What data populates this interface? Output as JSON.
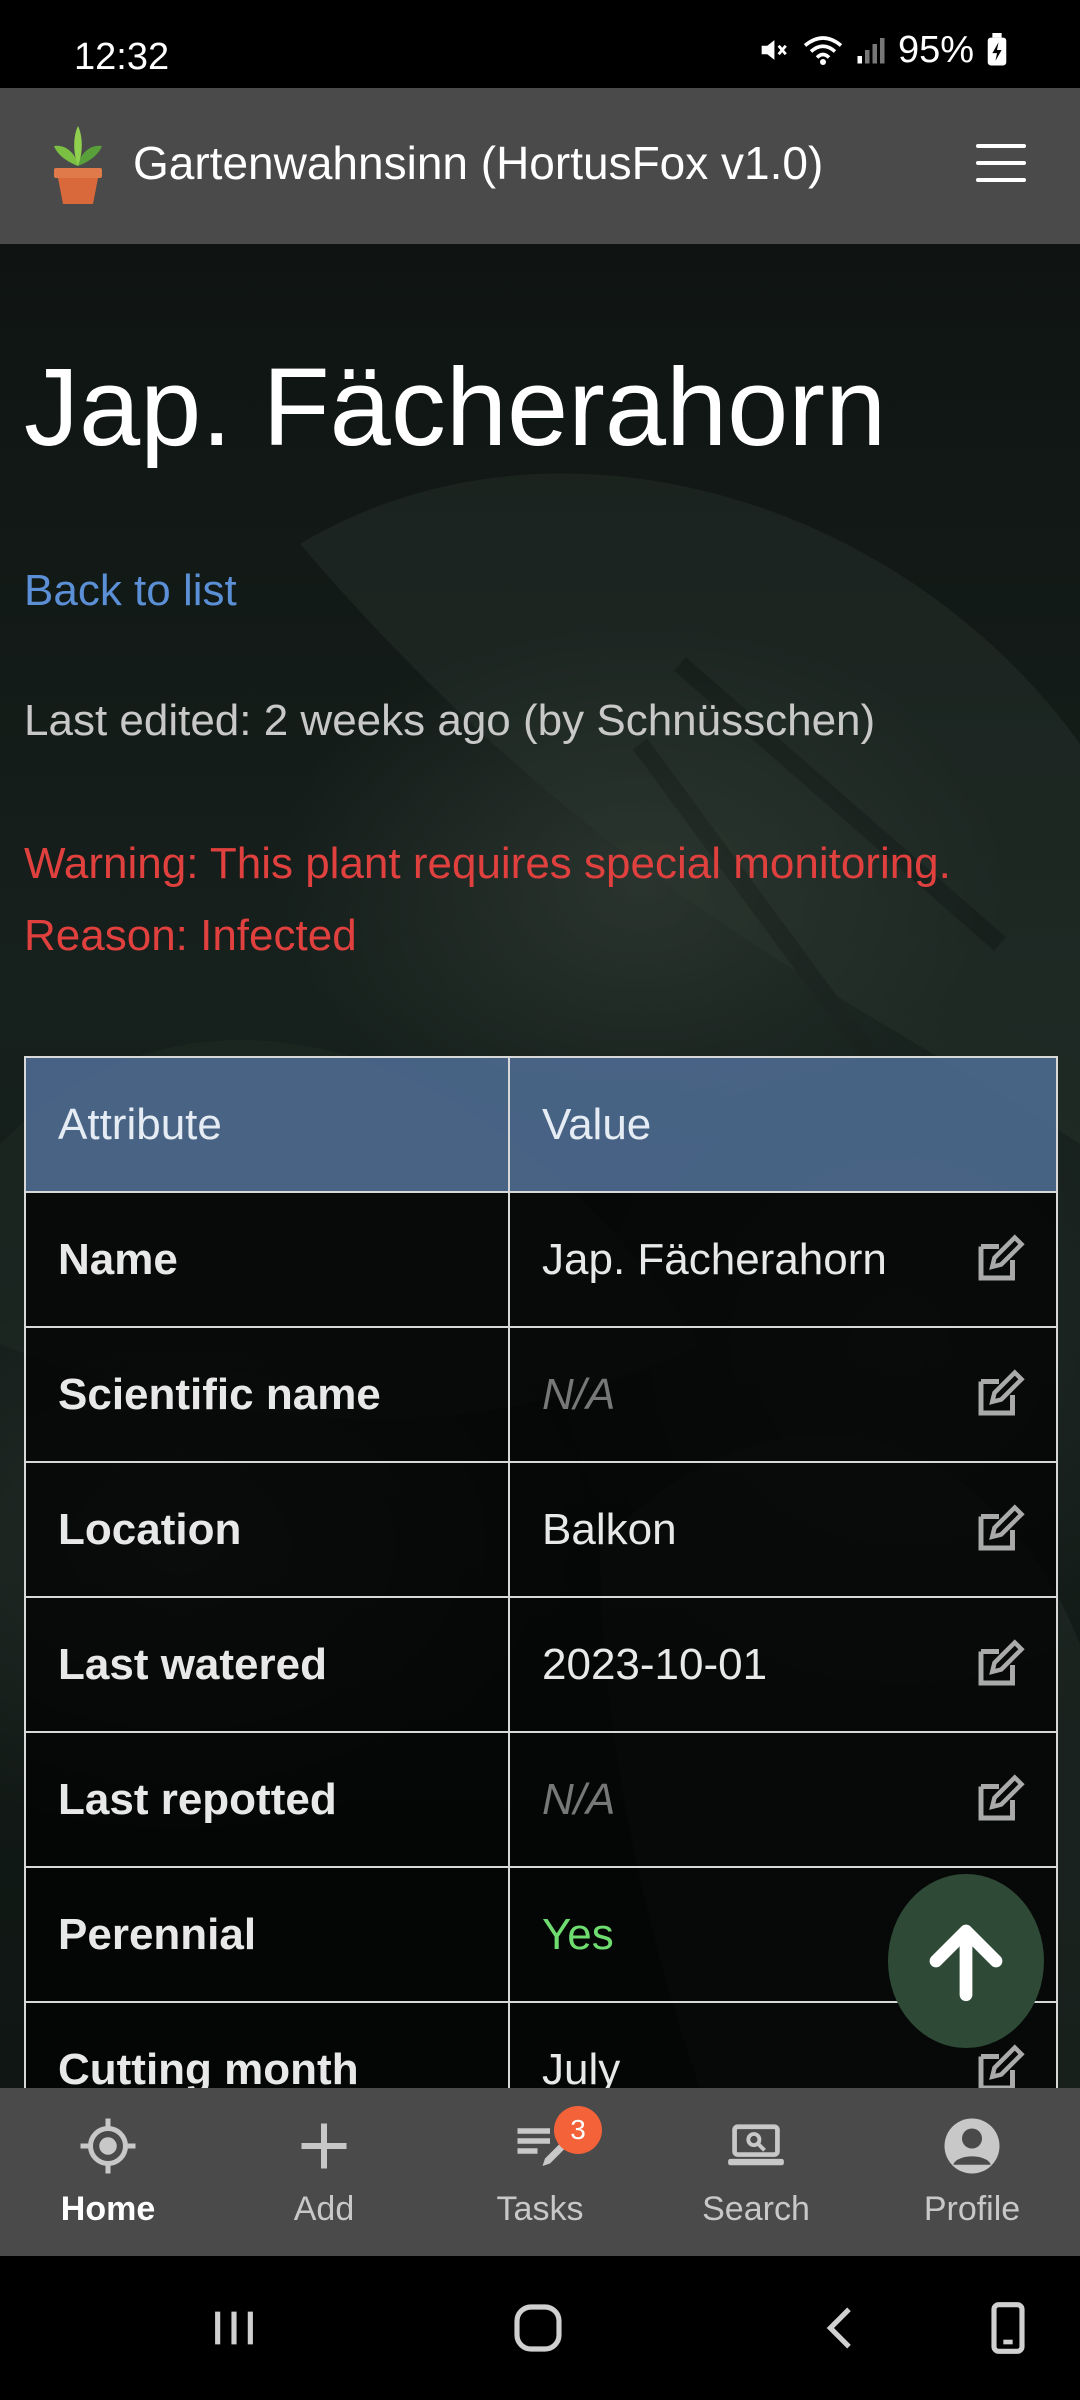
{
  "status_bar": {
    "time": "12:32",
    "battery": "95%"
  },
  "appbar": {
    "title": "Gartenwahnsinn (HortusFox v1.0)",
    "logo_icon": "potted-plant-icon",
    "menu_icon": "hamburger-menu-icon"
  },
  "plant": {
    "title": "Jap. Fächerahorn",
    "back_link": "Back to list",
    "last_edited": "Last edited: 2 weeks ago (by Schnüsschen)",
    "warning_line1": "Warning: This plant requires special monitoring.",
    "warning_line2": "Reason: Infected"
  },
  "table": {
    "headers": [
      "Attribute",
      "Value"
    ],
    "rows": [
      {
        "attribute": "Name",
        "value": "Jap. Fächerahorn",
        "style": "normal"
      },
      {
        "attribute": "Scientific name",
        "value": "N/A",
        "style": "na"
      },
      {
        "attribute": "Location",
        "value": "Balkon",
        "style": "normal"
      },
      {
        "attribute": "Last watered",
        "value": "2023-10-01",
        "style": "normal"
      },
      {
        "attribute": "Last repotted",
        "value": "N/A",
        "style": "na"
      },
      {
        "attribute": "Perennial",
        "value": "Yes",
        "style": "green"
      },
      {
        "attribute": "Cutting month",
        "value": "July",
        "style": "normal"
      }
    ]
  },
  "bottom_nav": {
    "items": [
      {
        "label": "Home",
        "icon": "home-target-icon",
        "active": true
      },
      {
        "label": "Add",
        "icon": "plus-icon",
        "active": false
      },
      {
        "label": "Tasks",
        "icon": "tasks-icon",
        "active": false,
        "badge": "3"
      },
      {
        "label": "Search",
        "icon": "laptop-search-icon",
        "active": false
      },
      {
        "label": "Profile",
        "icon": "profile-icon",
        "active": false
      }
    ]
  },
  "colors": {
    "appbar": "#4a4a4a",
    "link": "#5b8fd6",
    "warning": "#e0403e",
    "table_header": "#506e96",
    "yes_green": "#6fdc6f",
    "badge": "#f4623a",
    "scroll_top": "#2e4a36"
  }
}
